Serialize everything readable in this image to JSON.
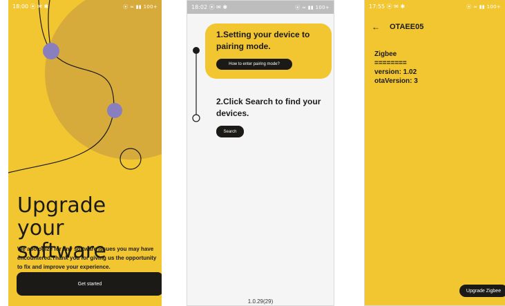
{
  "screen_onboarding": {
    "status": {
      "time": "18:00",
      "icons_left": "⦿ ✉ ✱",
      "icons_right": "⦿ ≈ ▮▮ 100+"
    },
    "headline": "Upgrade your software",
    "description": "We apologize for any software issues you may have encountered.Thank you for giving us the opportunity to fix and improve your experience.",
    "cta_label": "Get started",
    "colors": {
      "background": "#f2c631",
      "blob": "#d6ab3b",
      "dots": "#8a7fbe",
      "button": "#1c1a17"
    }
  },
  "screen_pairing": {
    "status": {
      "time": "18:02",
      "icons_left": "⦿ ✉ ✱",
      "icons_right": "⦿ ≈ ▮▮ 100+"
    },
    "step1_text": "1.Setting your device to pairing mode.",
    "pairing_button": "How to enter pairing mode?",
    "step2_text": "2.Click Search to find your devices.",
    "search_button": "Search",
    "app_version": "1.0.29(29)"
  },
  "screen_device": {
    "status": {
      "time": "17:55",
      "icons_left": "⦿ ✉ ✱",
      "icons_right": "⦿ ≈ ▮▮ 100+"
    },
    "title": "OTAEE05",
    "info_lines": [
      "Zigbee",
      "========",
      "version: 1.02",
      "otaVersion: 3"
    ],
    "upgrade_button": "Upgrade Zigbee"
  }
}
